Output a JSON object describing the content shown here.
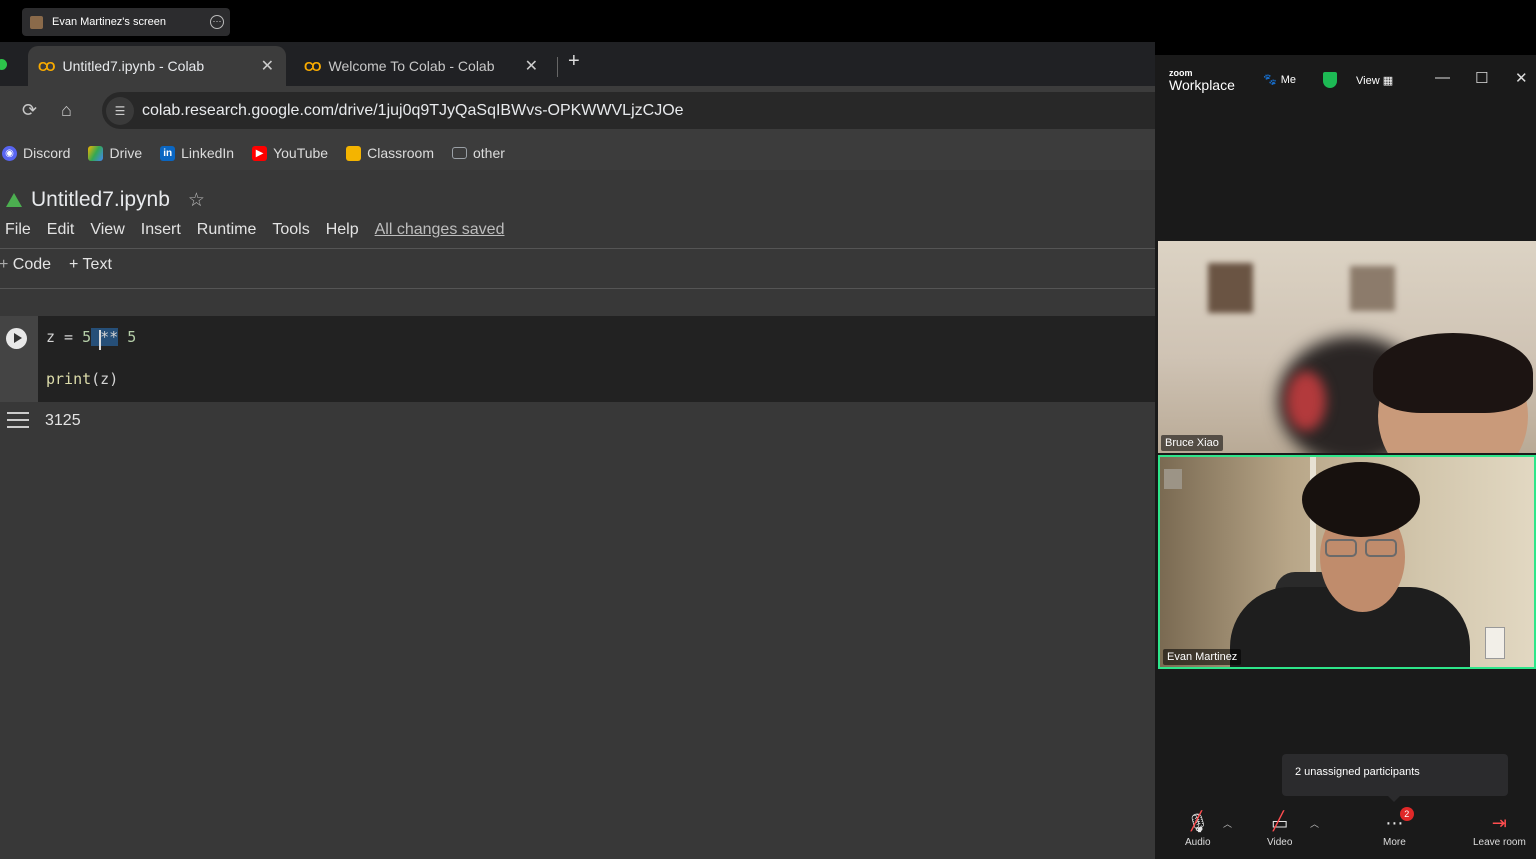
{
  "share_bar": {
    "label": "Evan Martinez's screen"
  },
  "browser": {
    "tabs": [
      {
        "label": "Untitled7.ipynb - Colab",
        "active": true
      },
      {
        "label": "Welcome To Colab - Colab",
        "active": false
      }
    ],
    "url": "colab.research.google.com/drive/1juj0q9TJyQaSqIBWvs-OPKWWVLjzCJOe",
    "bookmarks": [
      {
        "label": "Discord",
        "icon": "discord-icon",
        "color": "#5865f2"
      },
      {
        "label": "Drive",
        "icon": "drive-icon",
        "color": "#34a853"
      },
      {
        "label": "LinkedIn",
        "icon": "linkedin-icon",
        "color": "#0a66c2"
      },
      {
        "label": "YouTube",
        "icon": "youtube-icon",
        "color": "#ff0000"
      },
      {
        "label": "Classroom",
        "icon": "classroom-icon",
        "color": "#f4b400"
      },
      {
        "label": "other",
        "icon": "folder-icon",
        "color": "#9aa0a6"
      }
    ]
  },
  "colab": {
    "title": "Untitled7.ipynb",
    "menu": [
      "File",
      "Edit",
      "View",
      "Insert",
      "Runtime",
      "Tools",
      "Help"
    ],
    "saved_status": "All changes saved",
    "add_code": "Code",
    "add_text": "+ Text",
    "cell": {
      "line1_prefix": "z = ",
      "line1_num1": "5",
      "line1_op": " **",
      "line1_num2": " 5",
      "line2_fn": "print",
      "line2_args": "(z)"
    },
    "output": "3125"
  },
  "zoom": {
    "logo_small": "zoom",
    "logo_big": "Workplace",
    "me_label": "Me",
    "view_label": "View",
    "participants": [
      {
        "name": "Bruce Xiao"
      },
      {
        "name": "Evan Martinez"
      }
    ],
    "tooltip": "2 unassigned participants",
    "controls": {
      "audio": "Audio",
      "video": "Video",
      "more": "More",
      "more_badge": "2",
      "leave": "Leave room"
    }
  }
}
